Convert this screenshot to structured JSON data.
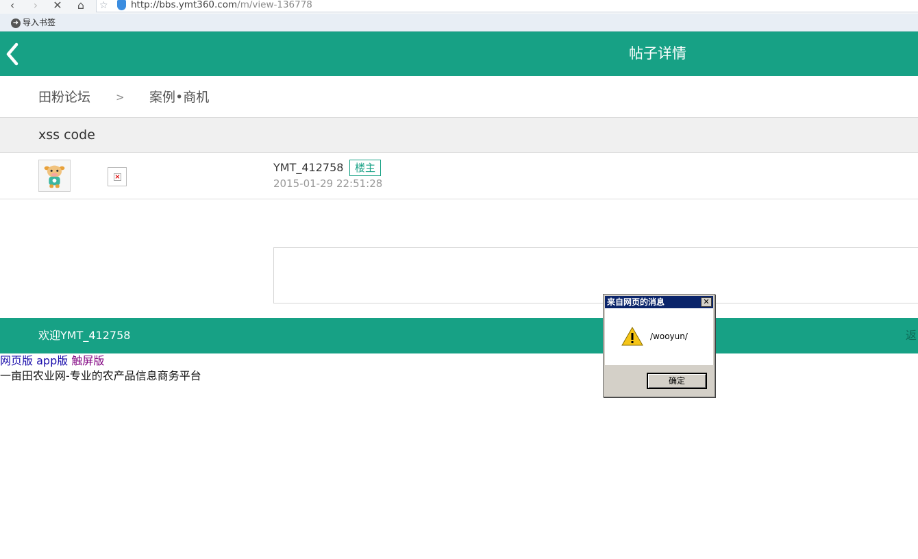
{
  "browser": {
    "url_host": "http://bbs.ymt360.com",
    "url_path": "/m/view-136778",
    "bookmark_label": "导入书签"
  },
  "header": {
    "title": "帖子详情"
  },
  "breadcrumb": {
    "forum": "田粉论坛",
    "separator": ">",
    "category": "案例•商机"
  },
  "post": {
    "title": "xss code",
    "author": "YMT_412758",
    "author_badge": "楼主",
    "time": "2015-01-29 22:51:28"
  },
  "footer": {
    "welcome": "欢迎YMT_412758",
    "back_link": "返"
  },
  "bottom_links": {
    "web": "网页版",
    "app": "app版",
    "touch": "触屏版",
    "slogan": "一亩田农业网-专业的农产品信息商务平台"
  },
  "dialog": {
    "title": "来自网页的消息",
    "close": "✕",
    "message": "/wooyun/",
    "ok_label": "确定"
  },
  "colors": {
    "brand": "#17a185",
    "dialog_title": "#0a246a"
  }
}
